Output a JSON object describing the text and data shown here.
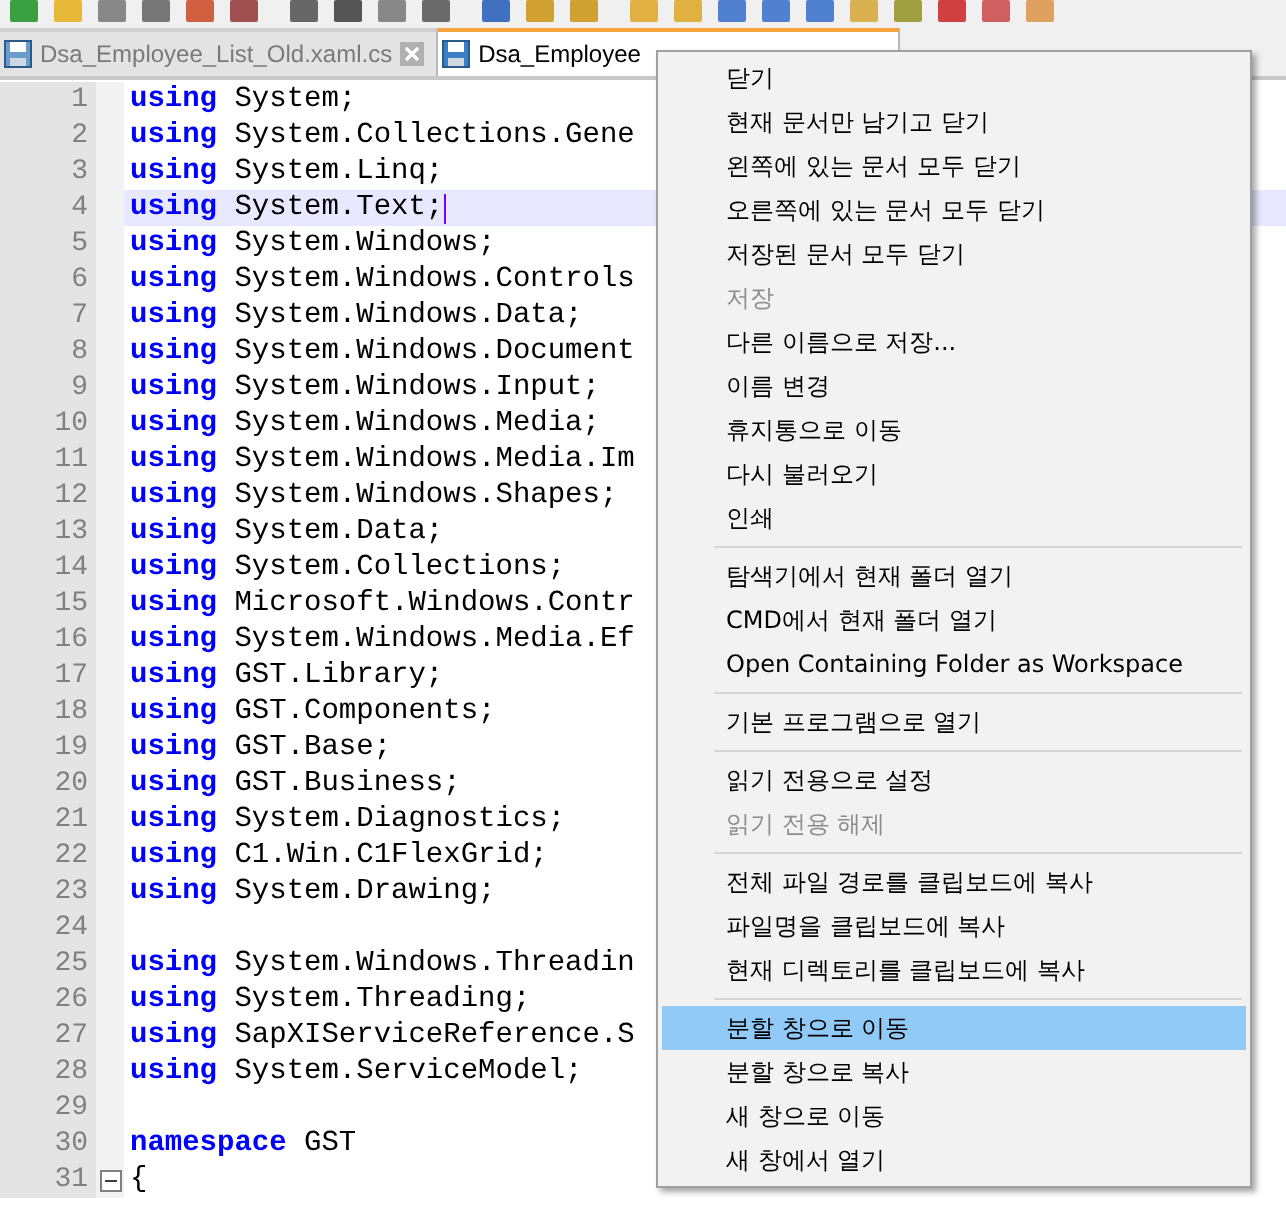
{
  "tabs": [
    {
      "label": "Dsa_Employee_List_Old.xaml.cs",
      "selected": false
    },
    {
      "label": "Dsa_Employee",
      "selected": true
    }
  ],
  "lines": [
    {
      "number": "1",
      "keyword": "using",
      "text": "System;",
      "current": false,
      "fold": false
    },
    {
      "number": "2",
      "keyword": "using",
      "text": "System.Collections.Gene",
      "current": false,
      "fold": false
    },
    {
      "number": "3",
      "keyword": "using",
      "text": "System.Linq;",
      "current": false,
      "fold": false
    },
    {
      "number": "4",
      "keyword": "using",
      "text": "System.Text;",
      "current": true,
      "fold": false
    },
    {
      "number": "5",
      "keyword": "using",
      "text": "System.Windows;",
      "current": false,
      "fold": false
    },
    {
      "number": "6",
      "keyword": "using",
      "text": "System.Windows.Controls",
      "current": false,
      "fold": false
    },
    {
      "number": "7",
      "keyword": "using",
      "text": "System.Windows.Data;",
      "current": false,
      "fold": false
    },
    {
      "number": "8",
      "keyword": "using",
      "text": "System.Windows.Document",
      "current": false,
      "fold": false
    },
    {
      "number": "9",
      "keyword": "using",
      "text": "System.Windows.Input;",
      "current": false,
      "fold": false
    },
    {
      "number": "10",
      "keyword": "using",
      "text": "System.Windows.Media;",
      "current": false,
      "fold": false
    },
    {
      "number": "11",
      "keyword": "using",
      "text": "System.Windows.Media.Im",
      "current": false,
      "fold": false
    },
    {
      "number": "12",
      "keyword": "using",
      "text": "System.Windows.Shapes;",
      "current": false,
      "fold": false
    },
    {
      "number": "13",
      "keyword": "using",
      "text": "System.Data;",
      "current": false,
      "fold": false
    },
    {
      "number": "14",
      "keyword": "using",
      "text": "System.Collections;",
      "current": false,
      "fold": false
    },
    {
      "number": "15",
      "keyword": "using",
      "text": "Microsoft.Windows.Contr",
      "current": false,
      "fold": false
    },
    {
      "number": "16",
      "keyword": "using",
      "text": "System.Windows.Media.Ef",
      "current": false,
      "fold": false
    },
    {
      "number": "17",
      "keyword": "using",
      "text": "GST.Library;",
      "current": false,
      "fold": false
    },
    {
      "number": "18",
      "keyword": "using",
      "text": "GST.Components;",
      "current": false,
      "fold": false
    },
    {
      "number": "19",
      "keyword": "using",
      "text": "GST.Base;",
      "current": false,
      "fold": false
    },
    {
      "number": "20",
      "keyword": "using",
      "text": "GST.Business;",
      "current": false,
      "fold": false
    },
    {
      "number": "21",
      "keyword": "using",
      "text": "System.Diagnostics;",
      "current": false,
      "fold": false
    },
    {
      "number": "22",
      "keyword": "using",
      "text": "C1.Win.C1FlexGrid;",
      "current": false,
      "fold": false
    },
    {
      "number": "23",
      "keyword": "using",
      "text": "System.Drawing;",
      "current": false,
      "fold": false
    },
    {
      "number": "24",
      "current": false,
      "fold": false
    },
    {
      "number": "25",
      "keyword": "using",
      "text": "System.Windows.Threadin",
      "current": false,
      "fold": false
    },
    {
      "number": "26",
      "keyword": "using",
      "text": "System.Threading;",
      "current": false,
      "fold": false
    },
    {
      "number": "27",
      "keyword": "using",
      "text": "SapXIServiceReference.S",
      "current": false,
      "fold": false
    },
    {
      "number": "28",
      "keyword": "using",
      "text": "System.ServiceModel;",
      "current": false,
      "fold": false
    },
    {
      "number": "29",
      "current": false,
      "fold": false
    },
    {
      "number": "30",
      "keyword": "namespace",
      "text": "GST",
      "current": false,
      "fold": false
    },
    {
      "number": "31",
      "text": "{",
      "current": false,
      "fold": true
    }
  ],
  "context_menu": [
    {
      "kind": "item",
      "label": "닫기",
      "disabled": false,
      "selected": false
    },
    {
      "kind": "item",
      "label": "현재 문서만 남기고 닫기",
      "disabled": false,
      "selected": false
    },
    {
      "kind": "item",
      "label": "왼쪽에 있는 문서 모두 닫기",
      "disabled": false,
      "selected": false
    },
    {
      "kind": "item",
      "label": "오른쪽에 있는 문서 모두 닫기",
      "disabled": false,
      "selected": false
    },
    {
      "kind": "item",
      "label": "저장된 문서 모두 닫기",
      "disabled": false,
      "selected": false
    },
    {
      "kind": "item",
      "label": "저장",
      "disabled": true,
      "selected": false
    },
    {
      "kind": "item",
      "label": "다른 이름으로 저장...",
      "disabled": false,
      "selected": false
    },
    {
      "kind": "item",
      "label": "이름 변경",
      "disabled": false,
      "selected": false
    },
    {
      "kind": "item",
      "label": "휴지통으로 이동",
      "disabled": false,
      "selected": false
    },
    {
      "kind": "item",
      "label": "다시 불러오기",
      "disabled": false,
      "selected": false
    },
    {
      "kind": "item",
      "label": "인쇄",
      "disabled": false,
      "selected": false
    },
    {
      "kind": "separator"
    },
    {
      "kind": "item",
      "label": "탐색기에서 현재 폴더 열기",
      "disabled": false,
      "selected": false
    },
    {
      "kind": "item",
      "label": "CMD에서 현재 폴더 열기",
      "disabled": false,
      "selected": false
    },
    {
      "kind": "item",
      "label": "Open Containing Folder as Workspace",
      "disabled": false,
      "selected": false
    },
    {
      "kind": "separator"
    },
    {
      "kind": "item",
      "label": "기본 프로그램으로 열기",
      "disabled": false,
      "selected": false
    },
    {
      "kind": "separator"
    },
    {
      "kind": "item",
      "label": "읽기 전용으로 설정",
      "disabled": false,
      "selected": false
    },
    {
      "kind": "item",
      "label": "읽기 전용 해제",
      "disabled": true,
      "selected": false
    },
    {
      "kind": "separator"
    },
    {
      "kind": "item",
      "label": "전체 파일 경로를 클립보드에 복사",
      "disabled": false,
      "selected": false
    },
    {
      "kind": "item",
      "label": "파일명을 클립보드에 복사",
      "disabled": false,
      "selected": false
    },
    {
      "kind": "item",
      "label": "현재 디렉토리를 클립보드에 복사",
      "disabled": false,
      "selected": false
    },
    {
      "kind": "separator"
    },
    {
      "kind": "item",
      "label": "분할 창으로 이동",
      "disabled": false,
      "selected": true
    },
    {
      "kind": "item",
      "label": "분할 창으로 복사",
      "disabled": false,
      "selected": false
    },
    {
      "kind": "item",
      "label": "새 창으로 이동",
      "disabled": false,
      "selected": false
    },
    {
      "kind": "item",
      "label": "새 창에서 열기",
      "disabled": false,
      "selected": false
    }
  ]
}
